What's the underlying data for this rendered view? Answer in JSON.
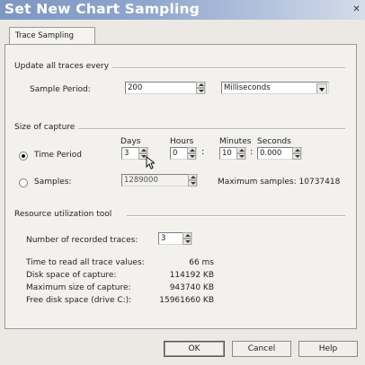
{
  "window": {
    "title": "Set New Chart Sampling",
    "close_icon": "close-icon"
  },
  "tabs": [
    {
      "label": "Trace Sampling",
      "active": true
    }
  ],
  "update_group": {
    "label": "Update all traces every",
    "sample_period_label": "Sample Period:",
    "sample_period_value": "200",
    "unit_value": "Milliseconds"
  },
  "capture_group": {
    "label": "Size of capture",
    "headers": {
      "days": "Days",
      "hours": "Hours",
      "minutes": "Minutes",
      "seconds": "Seconds"
    },
    "time_period": {
      "label": "Time Period",
      "selected": true,
      "days": "3",
      "hours": "0",
      "minutes": "10",
      "seconds": "0.000"
    },
    "samples": {
      "label": "Samples:",
      "selected": false,
      "value": "1289000",
      "max_text": "Maximum samples: 10737418"
    }
  },
  "resource_group": {
    "label": "Resource utilization tool",
    "recorded_traces_label": "Number of recorded traces:",
    "recorded_traces_value": "3",
    "stats": [
      {
        "label": "Time to read all trace values:",
        "value": "66 ms"
      },
      {
        "label": "Disk space of capture:",
        "value": "114192 KB"
      },
      {
        "label": "Maximum size of capture:",
        "value": "943740 KB"
      },
      {
        "label": "Free disk space (drive C:):",
        "value": "15961660 KB"
      }
    ]
  },
  "buttons": {
    "ok": "OK",
    "cancel": "Cancel",
    "help": "Help"
  },
  "colors": {
    "titlebar_start": "#7d97c3",
    "titlebar_end": "#d5dcea",
    "dialog_bg": "#ece9e4"
  }
}
